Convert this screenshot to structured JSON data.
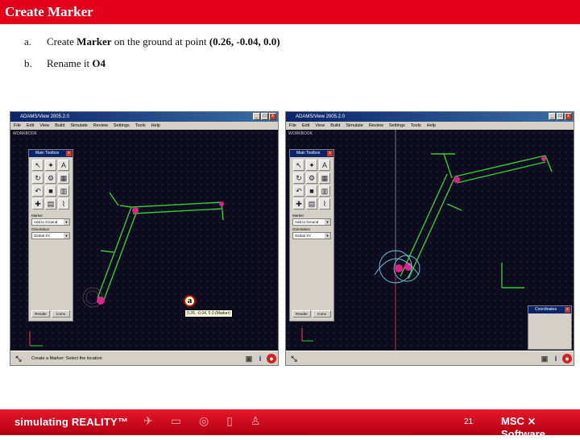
{
  "slide": {
    "title": "Create Marker",
    "steps": [
      {
        "marker": "a.",
        "pre": "Create ",
        "bold1": "Marker",
        "mid": " on the ground at point ",
        "bold2": "(0.26, -0.04, 0.0)"
      },
      {
        "marker": "b.",
        "pre": "Rename it ",
        "bold1": "O4",
        "mid": "",
        "bold2": ""
      }
    ]
  },
  "left_window": {
    "title": "ADAMS/View 2005.2.0",
    "menu": [
      "File",
      "Edit",
      "View",
      "Build",
      "Simulate",
      "Review",
      "Settings",
      "Tools",
      "Help"
    ],
    "viewport_label": "WORKBOOK",
    "toolbox": {
      "title": "Main Toolbox",
      "tools": [
        "select-icon",
        "view-icon",
        "text-icon",
        "rotate-icon",
        "joint-icon",
        "table-icon",
        "undo-icon",
        "camera-icon",
        "grid-icon",
        "force-icon",
        "database-icon",
        "graph-icon"
      ],
      "marker_label": "Marker",
      "marker_value": "Add to Ground",
      "orientation_label": "Orientation",
      "orientation_value": "Global XY",
      "buttons": [
        "Render",
        "Icons"
      ]
    },
    "callout": "a",
    "tooltip": "0.26, -0.04, 0.0 (Marker)",
    "status_text": "Create a Marker: Select the location",
    "status_icons": [
      "tool-icon",
      "info-icon",
      "stop-icon"
    ]
  },
  "right_window": {
    "title": "ADAMS/View 2005.2.0",
    "menu": [
      "File",
      "Edit",
      "View",
      "Build",
      "Simulate",
      "Review",
      "Settings",
      "Tools",
      "Help"
    ],
    "viewport_label": "WORKBOOK",
    "toolbox": {
      "title": "Main Toolbox",
      "tools": [
        "select-icon",
        "view-icon",
        "text-icon",
        "rotate-icon",
        "joint-icon",
        "table-icon",
        "undo-icon",
        "camera-icon",
        "grid-icon",
        "force-icon",
        "database-icon",
        "graph-icon"
      ],
      "marker_label": "Marker",
      "marker_value": "Add to Ground",
      "orientation_label": "Orientation",
      "orientation_value": "Global XY",
      "buttons": [
        "Render",
        "Icons"
      ]
    },
    "coordinates_title": "Coordinates",
    "status_icons": [
      "tool-icon",
      "info-icon",
      "stop-icon"
    ]
  },
  "footer": {
    "tagline": "simulating REALITY™",
    "page_number": "21",
    "logo": "MSC ⨯ Software"
  },
  "colors": {
    "brand_red": "#e3001b",
    "link_green": "#33cc33",
    "joint_magenta": "#e0208a"
  }
}
